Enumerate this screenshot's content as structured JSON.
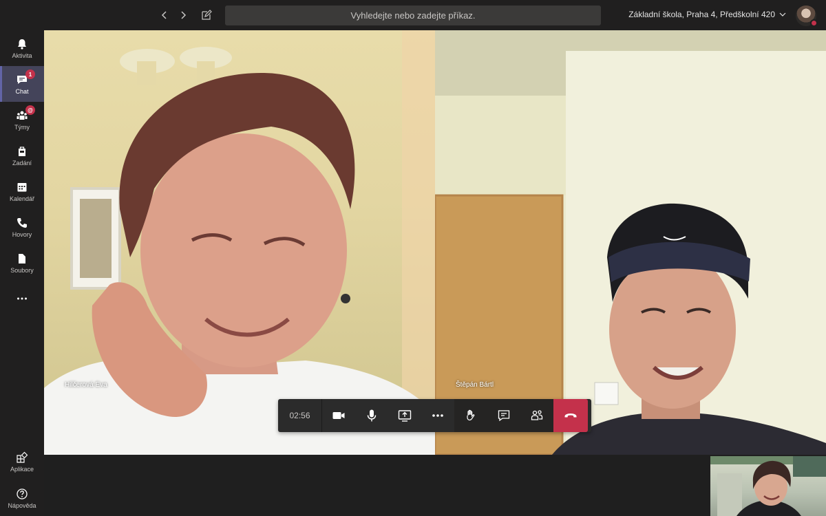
{
  "topbar": {
    "search_placeholder": "Vyhledejte nebo zadejte příkaz.",
    "organization": "Základní škola, Praha 4, Předškolní 420"
  },
  "rail": {
    "items": [
      {
        "label": "Aktivita",
        "icon": "bell-icon"
      },
      {
        "label": "Chat",
        "icon": "chat-icon",
        "badge": "1",
        "active": true
      },
      {
        "label": "Týmy",
        "icon": "teams-icon",
        "badge": "@"
      },
      {
        "label": "Zadání",
        "icon": "assignments-icon"
      },
      {
        "label": "Kalendář",
        "icon": "calendar-icon"
      },
      {
        "label": "Hovory",
        "icon": "phone-icon"
      },
      {
        "label": "Soubory",
        "icon": "file-icon"
      },
      {
        "label": "",
        "icon": "more-icon"
      }
    ],
    "bottom": [
      {
        "label": "Aplikace",
        "icon": "apps-icon"
      },
      {
        "label": "Nápověda",
        "icon": "help-icon"
      }
    ]
  },
  "call": {
    "participants": [
      {
        "name": "Hilčerová Eva"
      },
      {
        "name": "Štěpán Bártl"
      }
    ],
    "timer": "02:56"
  },
  "colors": {
    "rail_bg": "#201f1f",
    "accent": "#6264a7",
    "hangup": "#c4314b",
    "control_bar": "#2b2b2b"
  }
}
